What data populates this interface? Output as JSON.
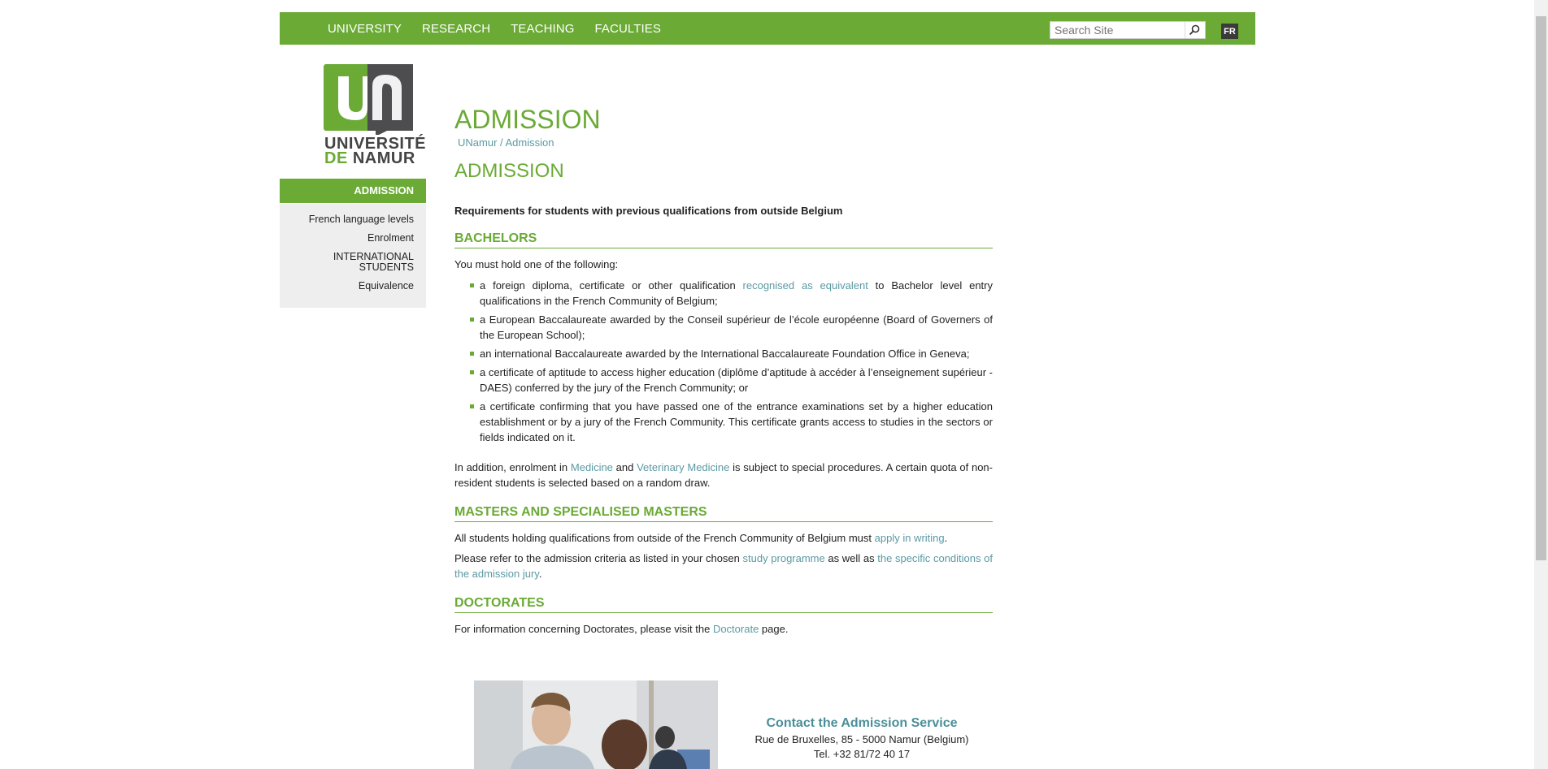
{
  "nav": {
    "items": [
      "UNIVERSITY",
      "RESEARCH",
      "TEACHING",
      "FACULTIES"
    ],
    "search_placeholder": "Search Site",
    "lang": "FR"
  },
  "logo": {
    "line1": "UNIVERSITÉ",
    "de": "DE",
    "namur": "NAMUR"
  },
  "sidebar": {
    "active": "ADMISSION",
    "items": [
      "French language levels",
      "Enrolment",
      "INTERNATIONAL STUDENTS",
      "Equivalence"
    ]
  },
  "main": {
    "title": "ADMISSION",
    "breadcrumb": "UNamur / Admission",
    "subtitle": "ADMISSION",
    "intro": "Requirements for students with previous qualifications from outside Belgium",
    "bachelors": {
      "heading": "BACHELORS",
      "lead": "You must hold one of the following:",
      "b1_pre": "a foreign diploma, certificate or other qualification ",
      "b1_link": "recognised as equivalent",
      "b1_post": " to Bachelor level entry qualifications in the French Community of Belgium;",
      "b2": "a European Baccalaureate awarded by the Conseil supérieur de l’école européenne (Board of Governers of the European School);",
      "b3": "an international Baccalaureate awarded by the International Baccalaureate Foundation Office in Geneva;",
      "b4": "a certificate of aptitude to access higher education (diplôme d’aptitude à accéder à l’enseignement supérieur - DAES) conferred by the jury of the French Community; or",
      "b5": "a certificate confirming that you have passed one of the entrance examinations set by a higher education establishment or by a jury of the French Community.  This certificate grants access to studies in the sectors or fields indicated on it.",
      "add_pre": "In addition, enrolment in ",
      "add_link1": "Medicine",
      "add_mid": " and ",
      "add_link2": "Veterinary Medicine",
      "add_post": " is subject to special procedures.  A certain quota of non-resident students is selected based on a random draw."
    },
    "masters": {
      "heading": "MASTERS AND SPECIALISED MASTERS",
      "p1_pre": "All students holding qualifications from outside of the French Community of Belgium must ",
      "p1_link": "apply in writing",
      "p1_post": ".",
      "p2_pre": "Please refer to the admission criteria as listed in your chosen ",
      "p2_link1": "study programme",
      "p2_mid": " as well as ",
      "p2_link2": "the specific conditions of the admission jury",
      "p2_post": "."
    },
    "doctorates": {
      "heading": "DOCTORATES",
      "p_pre": "For information concerning Doctorates, please visit the ",
      "p_link": "Doctorate",
      "p_post": " page."
    }
  },
  "contact": {
    "title": "Contact the Admission Service",
    "address": "Rue de Bruxelles, 85 - 5000 Namur (Belgium)",
    "tel": "Tel. +32 81/72 40 17"
  },
  "colors": {
    "brand_green": "#6aaa35",
    "link": "#5a9aa3"
  }
}
